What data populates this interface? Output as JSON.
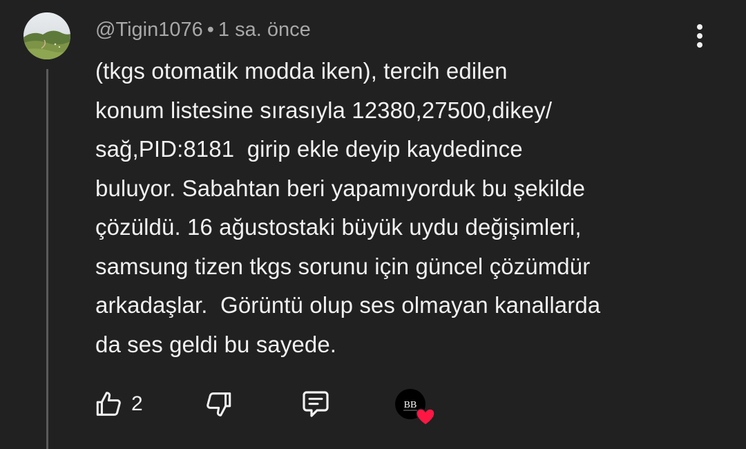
{
  "comment": {
    "author": "@Tigin1076",
    "separator": "•",
    "time": "1 sa. önce",
    "lines": [
      "(tkgs otomatik modda iken), tercih edilen",
      "konum listesine sırasıyla 12380,27500,dikey/",
      "sağ,PID:8181  girip ekle deyip kaydedince",
      "buluyor. Sabahtan beri yapamıyorduk bu şekilde",
      "çözüldü. 16 ağustostaki büyük uydu değişimleri,",
      "samsung tizen tkgs sorunu için güncel çözümdür",
      "arkadaşlar.  Görüntü olup ses olmayan kanallarda",
      "da ses geldi bu sayede."
    ]
  },
  "actions": {
    "like_count": "2",
    "like_icon": "thumbs-up-icon",
    "dislike_icon": "thumbs-down-icon",
    "reply_icon": "comment-icon",
    "creator_heart": {
      "badge_text": "BB",
      "heart_color": "#ff1744"
    }
  },
  "menu_icon": "more-vertical-icon"
}
